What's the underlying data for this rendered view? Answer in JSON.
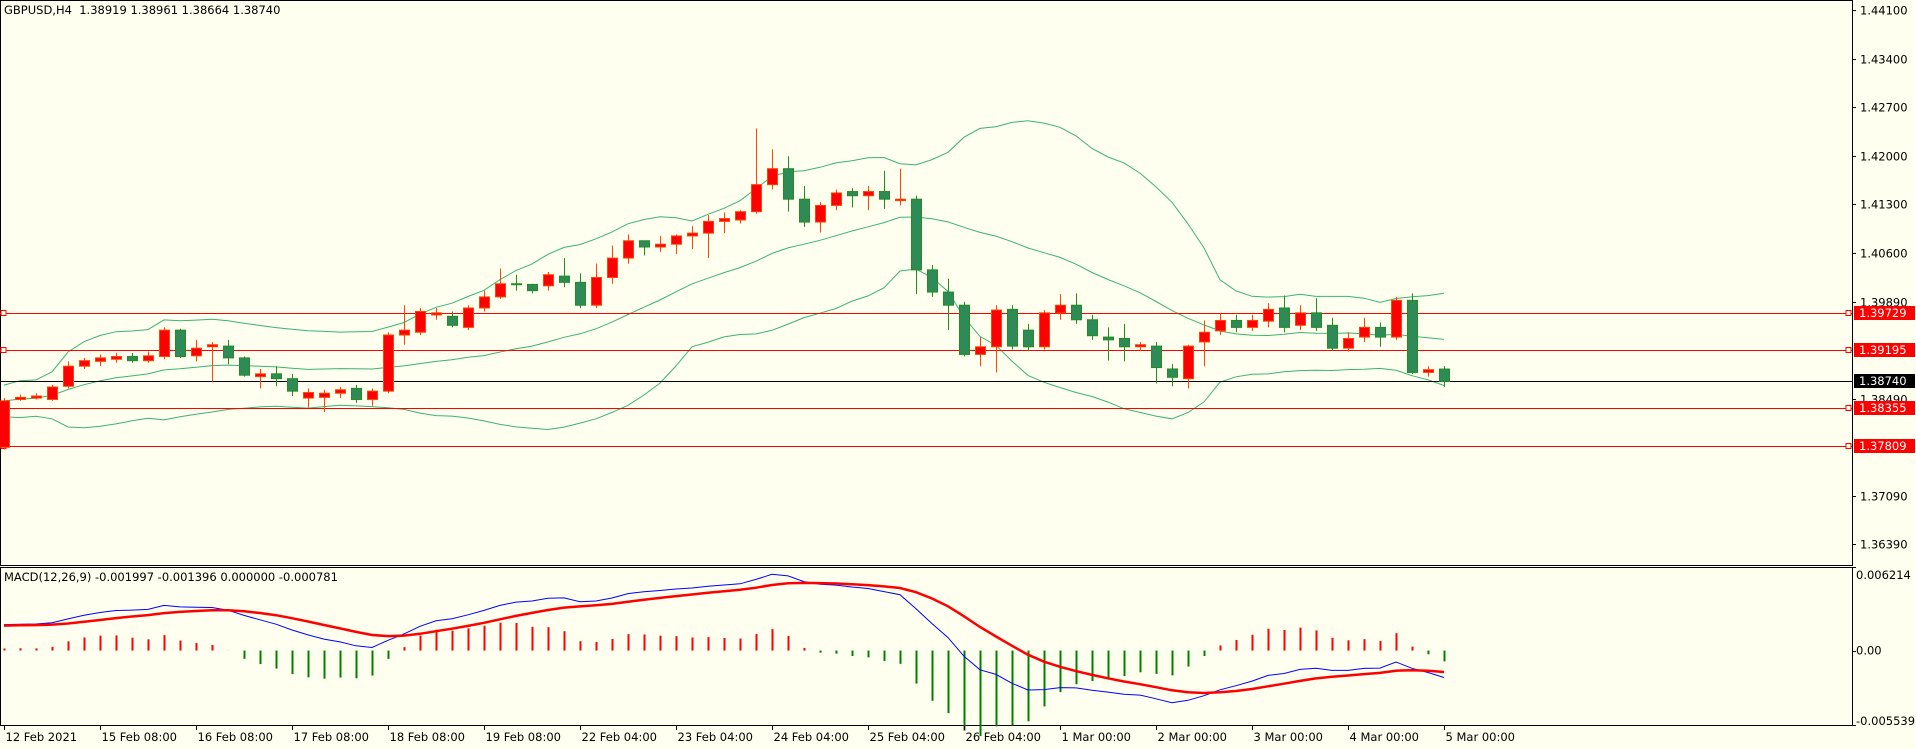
{
  "header": {
    "symbol_info": "GBPUSD,H4  1.38919 1.38961 1.38664 1.38740",
    "macd_info": "MACD(12,26,9) -0.001997 -0.001396 0.000000 -0.000781"
  },
  "colors": {
    "background": "#fffff0",
    "bull_body": "#ff0000",
    "bull_border": "#ff4500",
    "bear_body": "#2e8b57",
    "bear_border": "#228b22",
    "bands": "#3cb371",
    "hline": "#ff0000",
    "bid_line": "#000000",
    "macd_main": "#0000ff",
    "macd_signal": "#ff0000",
    "hist_pos": "#ff0000",
    "hist_neg": "#008000"
  },
  "chart_data": [
    {
      "type": "candlestick",
      "title": "GBPUSD,H4",
      "ylim": [
        1.3633,
        1.4416
      ],
      "y_ticks": [
        "1.44100",
        "1.43400",
        "1.42700",
        "1.42000",
        "1.41300",
        "1.40600",
        "1.39890",
        "1.38490",
        "1.37090",
        "1.36390"
      ],
      "price_labels": [
        {
          "value": "1.39729",
          "kind": "level"
        },
        {
          "value": "1.39195",
          "kind": "level"
        },
        {
          "value": "1.38740",
          "kind": "bid"
        },
        {
          "value": "1.38355",
          "kind": "level"
        },
        {
          "value": "1.37809",
          "kind": "level"
        }
      ],
      "x_labels": [
        "12 Feb 2021",
        "15 Feb 08:00",
        "16 Feb 08:00",
        "17 Feb 08:00",
        "18 Feb 08:00",
        "19 Feb 08:00",
        "22 Feb 04:00",
        "23 Feb 04:00",
        "24 Feb 04:00",
        "25 Feb 04:00",
        "26 Feb 04:00",
        "1 Mar 00:00",
        "2 Mar 00:00",
        "3 Mar 00:00",
        "4 Mar 00:00",
        "5 Mar 00:00"
      ],
      "bars_per_label": 6,
      "indicators": [
        "Bollinger Bands(20,2)"
      ],
      "ohlc": [
        [
          1.3779,
          1.385,
          1.3776,
          1.3846
        ],
        [
          1.3848,
          1.3855,
          1.3846,
          1.3851
        ],
        [
          1.385,
          1.3857,
          1.3848,
          1.3853
        ],
        [
          1.3848,
          1.3869,
          1.3846,
          1.3866
        ],
        [
          1.3867,
          1.3903,
          1.3864,
          1.3896
        ],
        [
          1.3896,
          1.3908,
          1.3892,
          1.3904
        ],
        [
          1.3903,
          1.3913,
          1.3896,
          1.3908
        ],
        [
          1.3906,
          1.3915,
          1.3901,
          1.391
        ],
        [
          1.391,
          1.3915,
          1.3901,
          1.3904
        ],
        [
          1.3904,
          1.3917,
          1.3901,
          1.3911
        ],
        [
          1.391,
          1.3952,
          1.3906,
          1.3948
        ],
        [
          1.3948,
          1.395,
          1.3908,
          1.391
        ],
        [
          1.3911,
          1.3934,
          1.3903,
          1.3922
        ],
        [
          1.3924,
          1.3931,
          1.3874,
          1.3927
        ],
        [
          1.3925,
          1.3934,
          1.3899,
          1.3908
        ],
        [
          1.3908,
          1.391,
          1.3881,
          1.3883
        ],
        [
          1.3881,
          1.3892,
          1.3864,
          1.3885
        ],
        [
          1.3885,
          1.3896,
          1.3867,
          1.3878
        ],
        [
          1.3878,
          1.3885,
          1.3853,
          1.386
        ],
        [
          1.385,
          1.3864,
          1.3836,
          1.3858
        ],
        [
          1.3851,
          1.3862,
          1.383,
          1.3857
        ],
        [
          1.3857,
          1.3866,
          1.385,
          1.3862
        ],
        [
          1.3864,
          1.3869,
          1.3843,
          1.3848
        ],
        [
          1.3848,
          1.3864,
          1.3839,
          1.386
        ],
        [
          1.386,
          1.3945,
          1.3857,
          1.3941
        ],
        [
          1.3941,
          1.3984,
          1.3927,
          1.3948
        ],
        [
          1.3945,
          1.398,
          1.3941,
          1.3975
        ],
        [
          1.397,
          1.398,
          1.3963,
          1.3973
        ],
        [
          1.3968,
          1.3975,
          1.3952,
          1.3955
        ],
        [
          1.3952,
          1.3984,
          1.3948,
          1.398
        ],
        [
          1.398,
          1.4005,
          1.3975,
          1.3996
        ],
        [
          1.3996,
          1.4037,
          1.3993,
          1.4015
        ],
        [
          1.4015,
          1.4028,
          1.4005,
          1.4014
        ],
        [
          1.4014,
          1.4015,
          1.4001,
          1.4005
        ],
        [
          1.4012,
          1.4032,
          1.4005,
          1.4028
        ],
        [
          1.4026,
          1.4052,
          1.401,
          1.4017
        ],
        [
          1.4017,
          1.403,
          1.398,
          1.3984
        ],
        [
          1.3984,
          1.4044,
          1.398,
          1.4024
        ],
        [
          1.4024,
          1.407,
          1.4015,
          1.4052
        ],
        [
          1.4052,
          1.4086,
          1.4044,
          1.4077
        ],
        [
          1.4077,
          1.4077,
          1.4056,
          1.4068
        ],
        [
          1.4068,
          1.4084,
          1.4061,
          1.4072
        ],
        [
          1.4072,
          1.4086,
          1.4058,
          1.4084
        ],
        [
          1.4084,
          1.4098,
          1.4065,
          1.4088
        ],
        [
          1.4088,
          1.4114,
          1.4052,
          1.4105
        ],
        [
          1.4105,
          1.4118,
          1.4088,
          1.4109
        ],
        [
          1.4107,
          1.4121,
          1.4102,
          1.4119
        ],
        [
          1.4119,
          1.4239,
          1.4116,
          1.4158
        ],
        [
          1.4158,
          1.4209,
          1.4151,
          1.4181
        ],
        [
          1.4181,
          1.4199,
          1.4119,
          1.4137
        ],
        [
          1.4137,
          1.4156,
          1.4097,
          1.4104
        ],
        [
          1.4104,
          1.4133,
          1.4089,
          1.4128
        ],
        [
          1.4128,
          1.4151,
          1.4121,
          1.4146
        ],
        [
          1.4148,
          1.4153,
          1.4125,
          1.4142
        ],
        [
          1.4142,
          1.4156,
          1.4121,
          1.4148
        ],
        [
          1.4148,
          1.4178,
          1.4123,
          1.4137
        ],
        [
          1.4135,
          1.4181,
          1.4128,
          1.4137
        ],
        [
          1.4137,
          1.4142,
          1.4,
          1.4035
        ],
        [
          1.4035,
          1.4042,
          1.3996,
          1.4003
        ],
        [
          1.4003,
          1.4022,
          1.3948,
          1.3984
        ],
        [
          1.3984,
          1.3989,
          1.391,
          1.3913
        ],
        [
          1.3913,
          1.3938,
          1.3896,
          1.3924
        ],
        [
          1.3924,
          1.3984,
          1.3887,
          1.3977
        ],
        [
          1.3978,
          1.3984,
          1.392,
          1.3925
        ],
        [
          1.3948,
          1.3957,
          1.3918,
          1.3924
        ],
        [
          1.3924,
          1.3977,
          1.392,
          1.3973
        ],
        [
          1.3973,
          1.4,
          1.3963,
          1.3984
        ],
        [
          1.3984,
          1.4001,
          1.3957,
          1.3963
        ],
        [
          1.3963,
          1.397,
          1.3934,
          1.394
        ],
        [
          1.3938,
          1.3952,
          1.3904,
          1.3934
        ],
        [
          1.3936,
          1.3957,
          1.3903,
          1.3924
        ],
        [
          1.3924,
          1.3931,
          1.3918,
          1.3927
        ],
        [
          1.3925,
          1.3931,
          1.3871,
          1.3894
        ],
        [
          1.3892,
          1.3899,
          1.3867,
          1.388
        ],
        [
          1.3878,
          1.3927,
          1.3864,
          1.3925
        ],
        [
          1.3931,
          1.3962,
          1.3896,
          1.3945
        ],
        [
          1.3947,
          1.3973,
          1.3941,
          1.3962
        ],
        [
          1.3962,
          1.397,
          1.3945,
          1.3952
        ],
        [
          1.3952,
          1.397,
          1.3947,
          1.3962
        ],
        [
          1.3961,
          1.3987,
          1.3952,
          1.3978
        ],
        [
          1.398,
          1.3998,
          1.3945,
          1.3952
        ],
        [
          1.3955,
          1.3984,
          1.3948,
          1.3973
        ],
        [
          1.3973,
          1.3994,
          1.3947,
          1.3952
        ],
        [
          1.3955,
          1.3966,
          1.3918,
          1.3922
        ],
        [
          1.3922,
          1.3945,
          1.3917,
          1.3936
        ],
        [
          1.3938,
          1.3966,
          1.3931,
          1.3952
        ],
        [
          1.3952,
          1.3959,
          1.3924,
          1.3938
        ],
        [
          1.3938,
          1.3996,
          1.3934,
          1.3991
        ],
        [
          1.3991,
          1.4001,
          1.3885,
          1.3887
        ],
        [
          1.3887,
          1.3896,
          1.3881,
          1.3891
        ],
        [
          1.38919,
          1.38961,
          1.38664,
          1.3874
        ]
      ]
    },
    {
      "type": "line",
      "title": "MACD(12,26,9)",
      "ylim": [
        -0.005539,
        0.006214
      ],
      "y_ticks": [
        "0.006214",
        "0.00",
        "-0.005539"
      ],
      "series": [
        {
          "name": "MACD main"
        },
        {
          "name": "Signal"
        },
        {
          "name": "Histogram"
        }
      ],
      "current_values": [
        -0.001997,
        -0.001396,
        0.0,
        -0.000781
      ]
    }
  ]
}
